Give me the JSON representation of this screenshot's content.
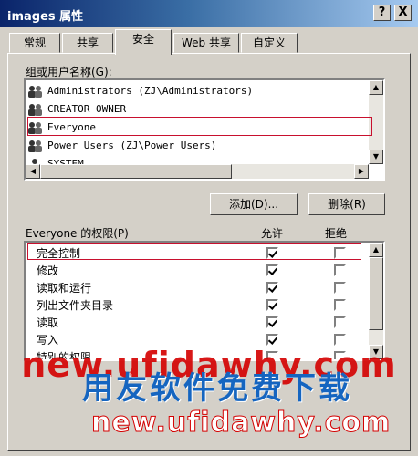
{
  "window": {
    "title": "images 属性",
    "help_button": "?",
    "close_button": "X"
  },
  "tabs": [
    {
      "label": "常规"
    },
    {
      "label": "共享"
    },
    {
      "label": "安全"
    },
    {
      "label": "Web 共享"
    },
    {
      "label": "自定义"
    }
  ],
  "active_tab": "安全",
  "users": {
    "label": "组或用户名称(G):",
    "items": [
      {
        "name": "Administrators (ZJ\\Administrators)"
      },
      {
        "name": "CREATOR OWNER"
      },
      {
        "name": "Everyone"
      },
      {
        "name": "Power Users (ZJ\\Power Users)"
      },
      {
        "name": "SYSTEM"
      }
    ],
    "selected": "Everyone"
  },
  "buttons": {
    "add": "添加(D)...",
    "remove": "删除(R)"
  },
  "permissions": {
    "header": "Everyone 的权限(P)",
    "allow_header": "允许",
    "deny_header": "拒绝",
    "rows": [
      {
        "name": "完全控制",
        "allow": true,
        "deny": false
      },
      {
        "name": "修改",
        "allow": true,
        "deny": false
      },
      {
        "name": "读取和运行",
        "allow": true,
        "deny": false
      },
      {
        "name": "列出文件夹目录",
        "allow": true,
        "deny": false
      },
      {
        "name": "读取",
        "allow": true,
        "deny": false
      },
      {
        "name": "写入",
        "allow": true,
        "deny": false
      },
      {
        "name": "特别的权限",
        "allow": false,
        "deny": false
      }
    ]
  },
  "watermark": {
    "line1": "new.ufidawhy.com",
    "line2": "用友软件免费下载",
    "line3": "new.ufidawhy.com"
  },
  "colors": {
    "titlebar_start": "#0a246a",
    "titlebar_end": "#a6caf0",
    "dialog_face": "#d4d0c8",
    "highlight_border": "#c8102e",
    "watermark_red": "#d40000",
    "watermark_blue": "#1565c0"
  }
}
